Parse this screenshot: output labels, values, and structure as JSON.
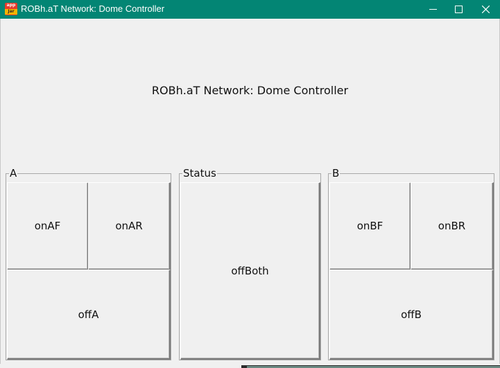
{
  "window": {
    "title": "ROBh.aT Network: Dome Controller",
    "icon": "java-app-jar-icon",
    "icon_text_top": "app",
    "icon_text_bottom": "Jar",
    "titlebar_color": "#038574",
    "controls": {
      "minimize": "minimize-icon",
      "maximize": "maximize-icon",
      "close": "close-icon"
    }
  },
  "heading": "ROBh.aT Network: Dome Controller",
  "groups": {
    "a": {
      "label": "A",
      "buttons": {
        "on_af": "onAF",
        "on_ar": "onAR",
        "off_a": "offA"
      }
    },
    "status": {
      "label": "Status",
      "buttons": {
        "off_both": "offBoth"
      }
    },
    "b": {
      "label": "B",
      "buttons": {
        "on_bf": "onBF",
        "on_br": "onBR",
        "off_b": "offB"
      }
    }
  }
}
